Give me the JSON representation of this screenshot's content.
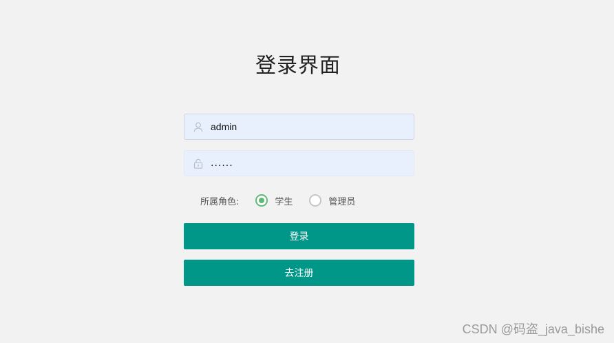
{
  "page": {
    "title": "登录界面"
  },
  "form": {
    "username": {
      "icon": "user-icon",
      "value": "admin"
    },
    "password": {
      "icon": "lock-icon",
      "value": "......"
    },
    "role": {
      "label": "所属角色:",
      "options": [
        {
          "label": "学生",
          "checked": true
        },
        {
          "label": "管理员",
          "checked": false
        }
      ]
    },
    "login_button": "登录",
    "register_button": "去注册"
  },
  "watermark": "CSDN @码盗_java_bishe",
  "colors": {
    "background": "#f2f2f2",
    "input_bg": "#e8f0fe",
    "primary_button": "#009688",
    "radio_checked": "#5fb878"
  }
}
